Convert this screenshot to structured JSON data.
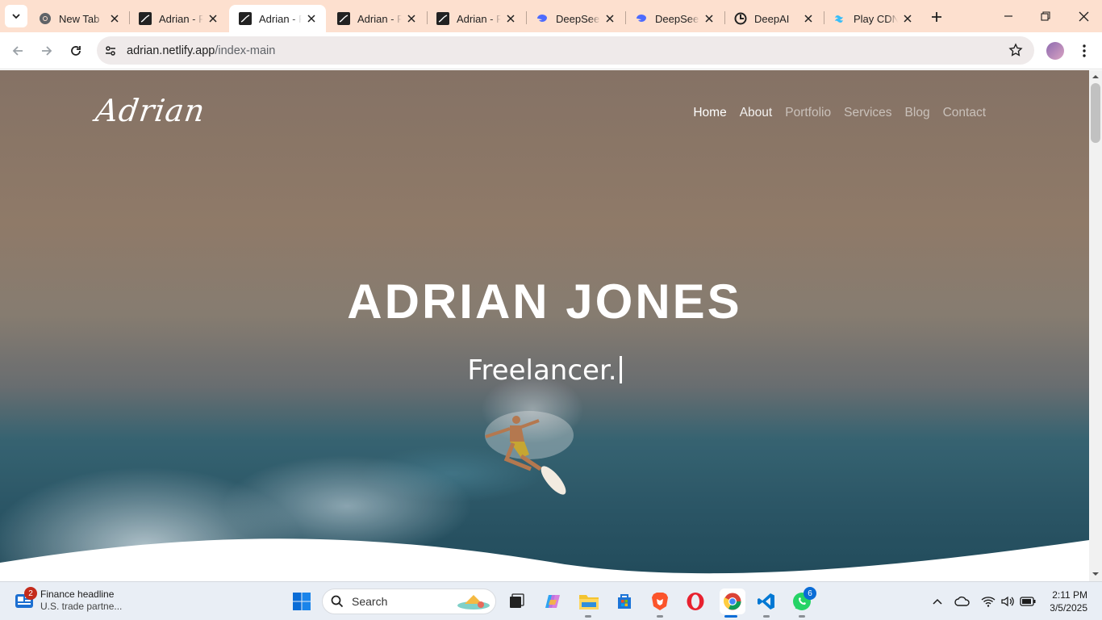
{
  "browser": {
    "tabs": [
      {
        "title": "New Tab",
        "icon": "chrome-icon",
        "active": false
      },
      {
        "title": "Adrian - Personal Portfolio",
        "icon": "adrian-favicon-icon",
        "active": false
      },
      {
        "title": "Adrian - Personal Portfolio",
        "icon": "adrian-favicon-icon",
        "active": true
      },
      {
        "title": "Adrian - Personal Portfolio",
        "icon": "adrian-favicon-icon",
        "active": false
      },
      {
        "title": "Adrian - Personal Portfolio",
        "icon": "adrian-favicon-icon",
        "active": false
      },
      {
        "title": "DeepSeek",
        "icon": "deepseek-icon",
        "active": false
      },
      {
        "title": "DeepSeek",
        "icon": "deepseek-icon",
        "active": false
      },
      {
        "title": "DeepAI",
        "icon": "deepai-icon",
        "active": false
      },
      {
        "title": "Play CDN",
        "icon": "tailwind-icon",
        "active": false
      }
    ],
    "url_host": "adrian.netlify.app",
    "url_path": "/index-main"
  },
  "page": {
    "logo": "Adrian",
    "nav": [
      "Home",
      "About",
      "Portfolio",
      "Services",
      "Blog",
      "Contact"
    ],
    "hero_title": "ADRIAN JONES",
    "hero_subtitle": "Freelancer."
  },
  "taskbar": {
    "news_badge": "2",
    "news_title": "Finance headline",
    "news_subtitle": "U.S. trade partne...",
    "search_label": "Search",
    "whatsapp_badge": "6",
    "time": "2:11 PM",
    "date": "3/5/2025"
  },
  "colors": {
    "tabstrip": "#fde0cf",
    "accent": "#1a73e8",
    "badge": "#c42b1c"
  }
}
